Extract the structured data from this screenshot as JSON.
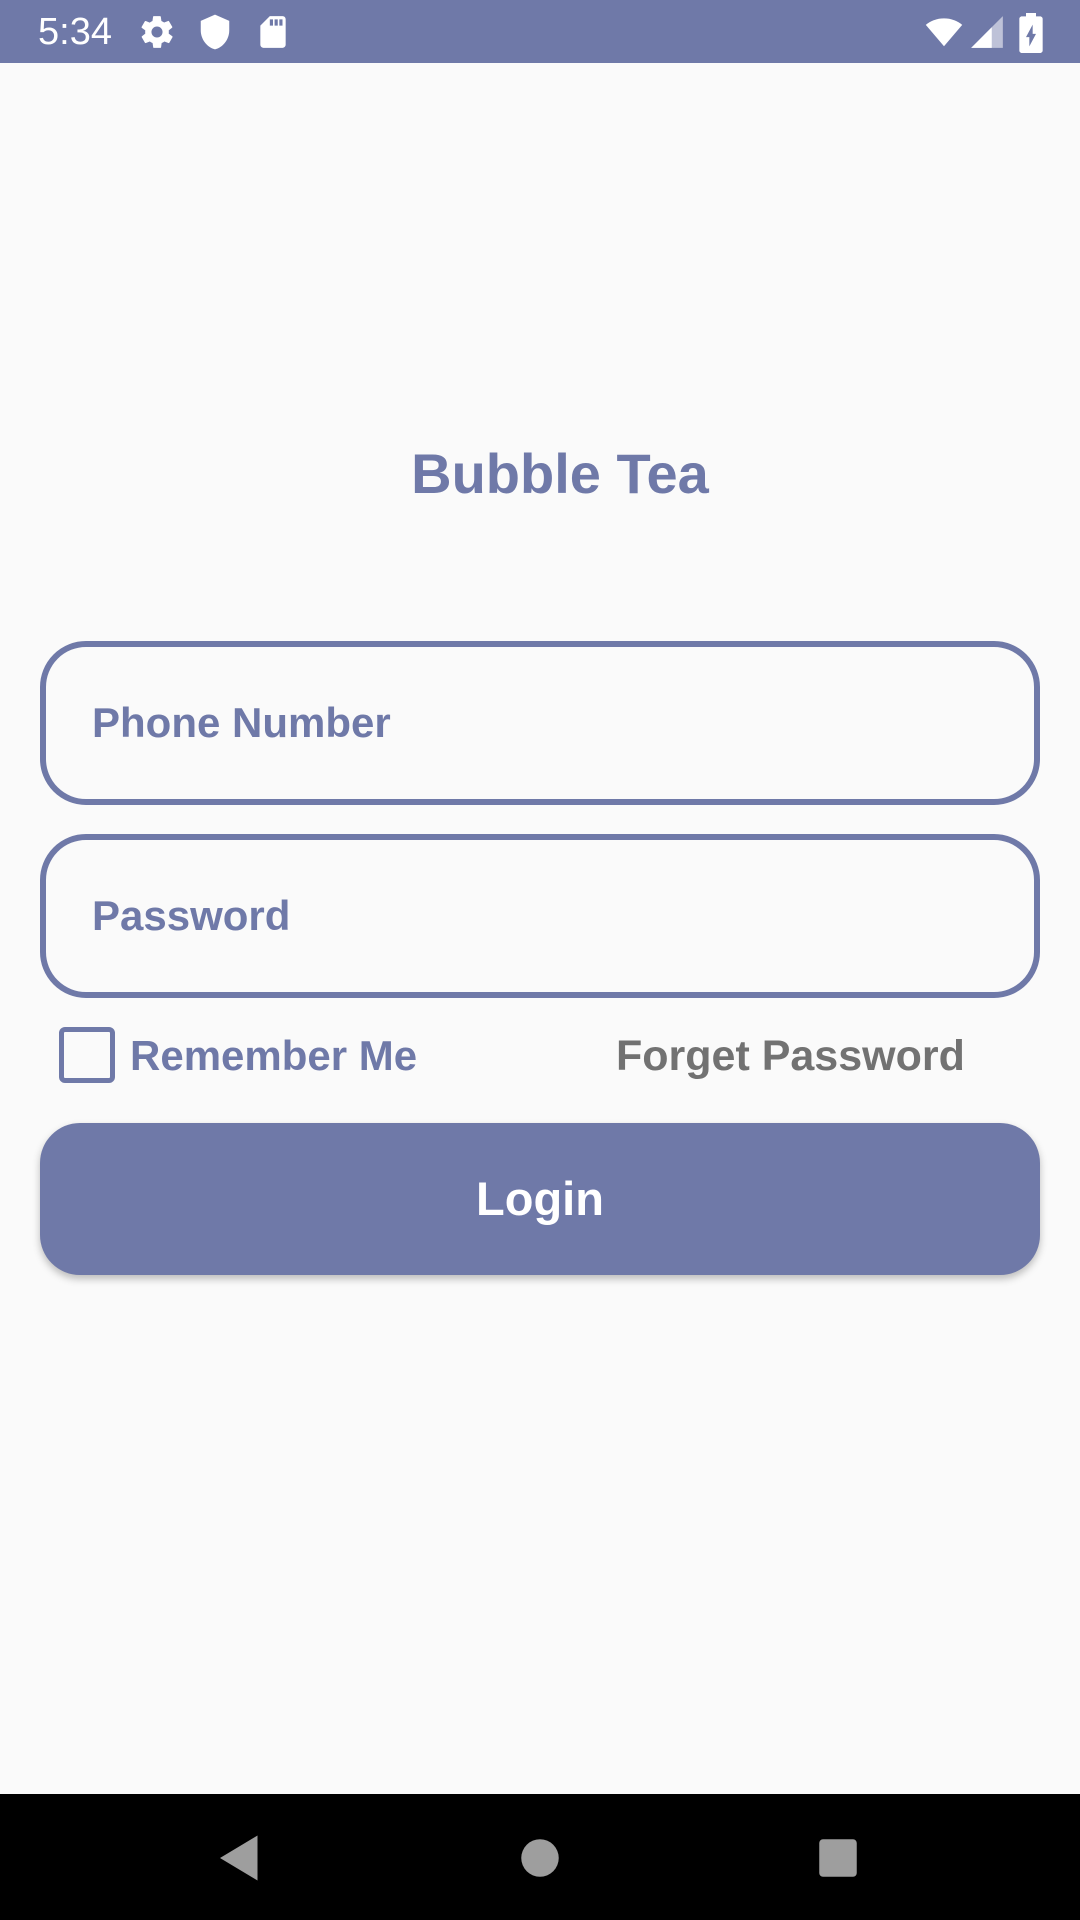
{
  "status_bar": {
    "time": "5:34",
    "icons": [
      "settings-icon",
      "shield-icon",
      "sd-card-icon",
      "wifi-icon",
      "cell-signal-icon",
      "battery-charging-icon"
    ]
  },
  "app": {
    "title": "Bubble Tea"
  },
  "form": {
    "phone_placeholder": "Phone Number",
    "phone_value": "",
    "password_placeholder": "Password",
    "password_value": "",
    "remember_label": "Remember Me",
    "remember_checked": false,
    "forget_label": "Forget Password",
    "login_label": "Login"
  },
  "nav_bar": {
    "buttons": [
      "back-icon",
      "home-icon",
      "recents-icon"
    ]
  },
  "colors": {
    "primary": "#6f79a8",
    "background": "#fafafa",
    "secondary_text": "#727272",
    "nav_background": "#000000"
  }
}
